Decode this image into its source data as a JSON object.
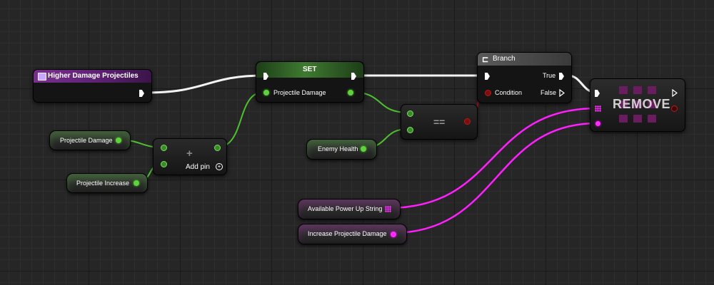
{
  "nodes": {
    "event": {
      "title": "Higher Damage Projectiles",
      "color": "#7a2f8f"
    },
    "set": {
      "title": "SET",
      "pin_label": "Projectile Damage",
      "color": "#3f7a30"
    },
    "add": {
      "symbol": "+",
      "add_pin_label": "Add pin"
    },
    "equal": {
      "symbol": "=="
    },
    "branch": {
      "title": "Branch",
      "condition_label": "Condition",
      "true_label": "True",
      "false_label": "False"
    },
    "remove": {
      "title": "REMOVE"
    }
  },
  "variables": [
    {
      "label": "Projectile Damage",
      "type": "float"
    },
    {
      "label": "Projectile Increase",
      "type": "float"
    },
    {
      "label": "Enemy Health",
      "type": "float"
    },
    {
      "label": "Available Power Up String",
      "type": "string-array"
    },
    {
      "label": "Increase Projectile Damage",
      "type": "string"
    }
  ],
  "colors": {
    "exec": "#ffffff",
    "float": "#5cd43a",
    "string": "#ff2bff",
    "bool": "#c01818"
  }
}
